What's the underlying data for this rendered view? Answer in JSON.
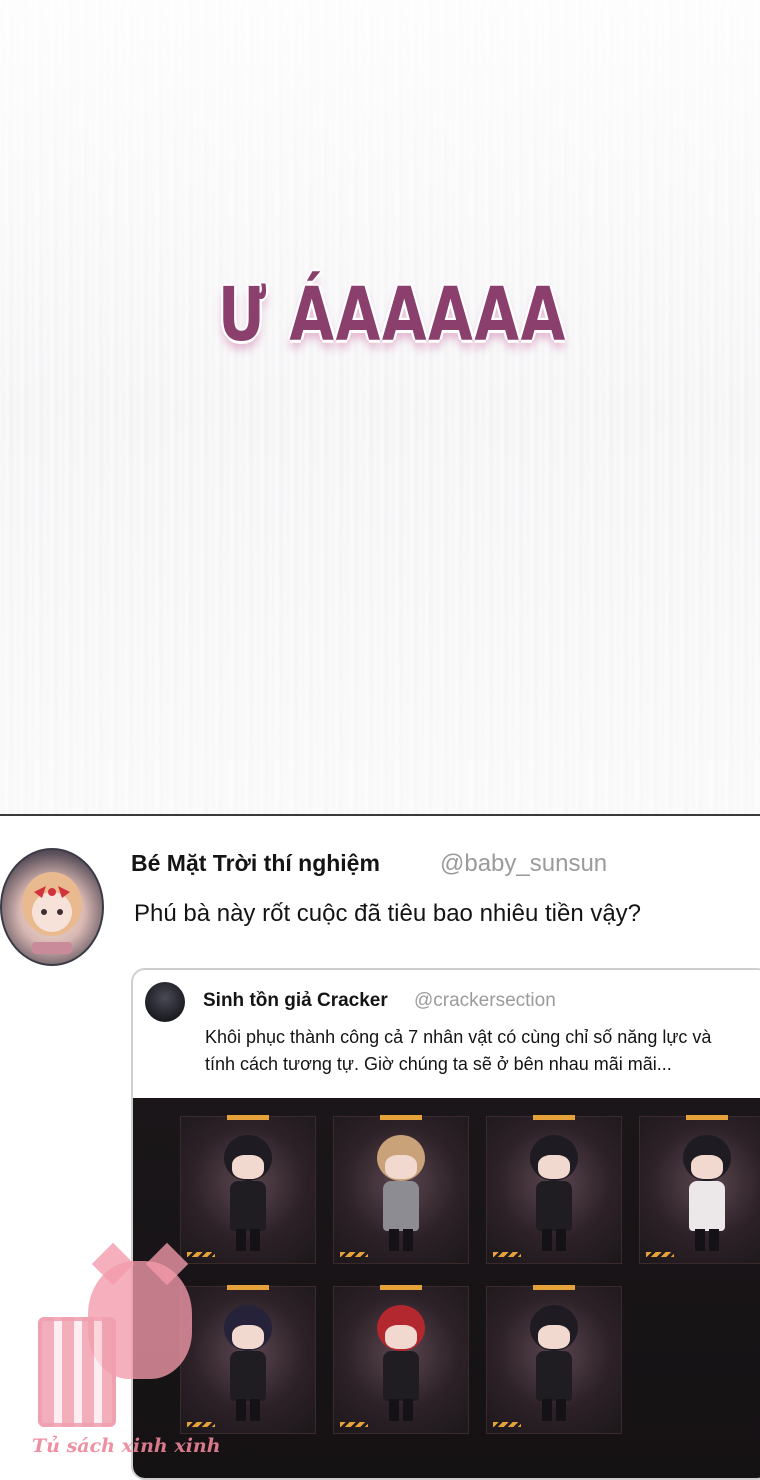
{
  "panel": {
    "sound_effect": "Ư ÁAAAAA"
  },
  "post": {
    "display_name": "Bé Mặt Trời thí nghiệm",
    "handle": "@baby_sunsun",
    "text": "Phú bà này rốt cuộc đã tiêu bao nhiêu tiền vậy?",
    "avatar_icon": "avatar-icon"
  },
  "quoted_post": {
    "display_name": "Sinh tồn giả Cracker",
    "handle": "@crackersection",
    "text": "Khôi phục thành công cả 7 nhân vật có cùng chỉ số năng lực và tính cách tương tự. Giờ chúng ta sẽ ở bên nhau mãi mãi...",
    "character_count": 7
  },
  "watermark": {
    "text": "Tủ sách xinh xinh"
  },
  "colors": {
    "sfx": "#8a3f6c",
    "accent_orange": "#e6a23a",
    "handle_gray": "#9b9b9b",
    "watermark_pink": "#f49aaa"
  }
}
